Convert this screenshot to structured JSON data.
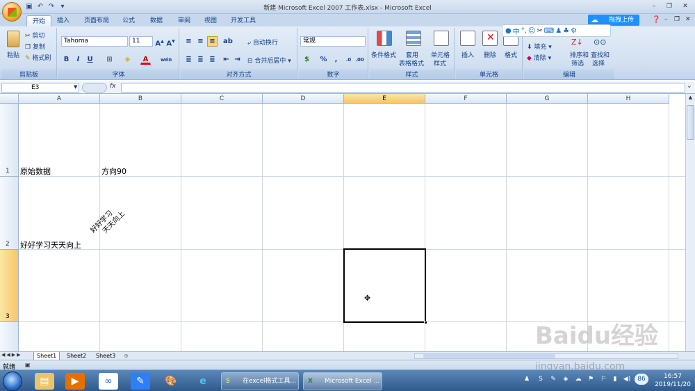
{
  "window": {
    "title": "新建 Microsoft Excel 2007 工作表.xlsx - Microsoft Excel"
  },
  "tabs": [
    "开始",
    "插入",
    "页面布局",
    "公式",
    "数据",
    "审阅",
    "视图",
    "开发工具"
  ],
  "cloud_upload": "拖拽上传",
  "clipboard": {
    "paste": "粘贴",
    "cut": "剪切",
    "copy": "复制",
    "format_painter": "格式刷",
    "label": "剪贴板"
  },
  "font": {
    "name": "Tahoma",
    "size": "11",
    "bold": "B",
    "italic": "I",
    "underline": "U",
    "color_a": "A",
    "label": "字体",
    "wen": "wén"
  },
  "alignment": {
    "wrap": "自动换行",
    "merge": "合并后居中",
    "label": "对齐方式"
  },
  "number": {
    "format": "常规",
    "percent": "%",
    "label": "数字"
  },
  "styles": {
    "conditional": "条件格式",
    "table_fmt_line1": "套用",
    "table_fmt_line2": "表格格式",
    "cell_style_line1": "单元格",
    "cell_style_line2": "样式",
    "label": "样式"
  },
  "cells": {
    "insert": "插入",
    "delete": "删除",
    "format": "格式",
    "label": "单元格"
  },
  "editing": {
    "fill": "填充",
    "clear": "清除",
    "sort_line1": "排序和",
    "sort_line2": "筛选",
    "find_line1": "查找和",
    "find_line2": "选择",
    "label": "编辑"
  },
  "formula_bar": {
    "namebox": "E3",
    "fx": "fx",
    "value": ""
  },
  "grid": {
    "columns": [
      "A",
      "B",
      "C",
      "D",
      "E",
      "F",
      "G",
      "H"
    ],
    "selected_col": "E",
    "rows": [
      {
        "num": "1",
        "a": "原始数据",
        "b": "方向90"
      },
      {
        "num": "2",
        "a": "好好学习天天向上",
        "b_line1": "好好学习",
        "b_line2": "天天向上"
      },
      {
        "num": "3"
      }
    ],
    "selected_row": "3",
    "active_cell": "E3"
  },
  "sheets": [
    "Sheet1",
    "Sheet2",
    "Sheet3"
  ],
  "status": {
    "ready": "就绪"
  },
  "taskbar": {
    "task1": "在excel格式工具...",
    "task2": "Microsoft Excel ...",
    "badge": "86",
    "time": "16:57",
    "date": "2019/11/20"
  },
  "watermark": {
    "logo": "Baidu经验",
    "url": "jingyan.baidu.com"
  }
}
